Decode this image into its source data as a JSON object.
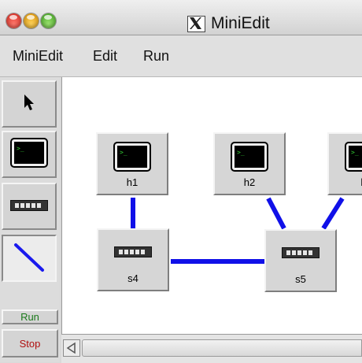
{
  "window": {
    "title": "MiniEdit",
    "app_icon": "x11-icon",
    "buttons": [
      "close-button",
      "minimize-button",
      "zoom-button"
    ]
  },
  "menu": {
    "items": [
      {
        "label": "MiniEdit"
      },
      {
        "label": "Edit"
      },
      {
        "label": "Run"
      }
    ]
  },
  "toolbar": {
    "tools": [
      {
        "name": "select",
        "icon": "arrow-cursor-icon",
        "selected": false
      },
      {
        "name": "host",
        "icon": "terminal-icon",
        "selected": false
      },
      {
        "name": "switch",
        "icon": "switch-icon",
        "selected": false
      },
      {
        "name": "link",
        "icon": "link-line-icon",
        "selected": true
      }
    ],
    "run_label": "Run",
    "stop_label": "Stop"
  },
  "canvas": {
    "nodes": [
      {
        "id": "h1",
        "type": "host",
        "label": "h1"
      },
      {
        "id": "h2",
        "type": "host",
        "label": "h2"
      },
      {
        "id": "h3",
        "type": "host",
        "label": "h"
      },
      {
        "id": "s4",
        "type": "switch",
        "label": "s4"
      },
      {
        "id": "s5",
        "type": "switch",
        "label": "s5"
      }
    ],
    "links": [
      {
        "from": "h1",
        "to": "s4"
      },
      {
        "from": "s4",
        "to": "s5"
      },
      {
        "from": "h2",
        "to": "s5"
      },
      {
        "from": "h3",
        "to": "s5"
      }
    ],
    "link_color": "#1010e8"
  },
  "colors": {
    "terminal_bg": "#000000",
    "terminal_prompt": "#33cc33",
    "run_text": "#1b7a1b",
    "stop_text": "#b01010"
  }
}
